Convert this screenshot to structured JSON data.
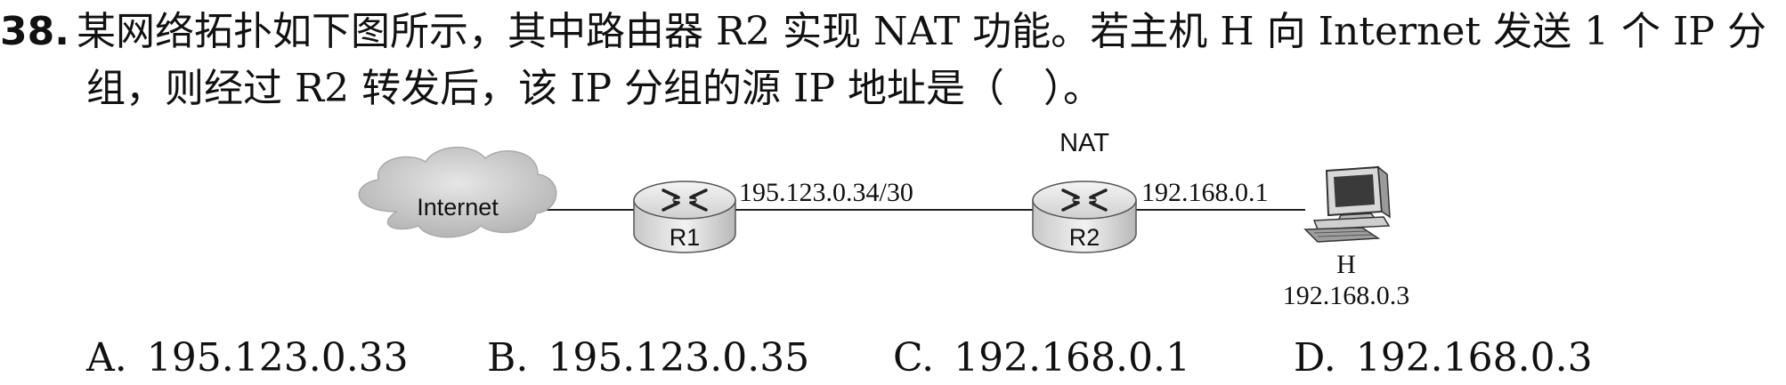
{
  "question": {
    "number": "38.",
    "line1": "某网络拓扑如下图所示，其中路由器 R2 实现 NAT 功能。若主机 H 向 Internet 发送 1 个 IP 分",
    "line2": "组，则经过 R2 转发后，该 IP 分组的源 IP 地址是（　）。"
  },
  "diagram": {
    "cloud_label": "Internet",
    "r1_label": "R1",
    "r1_link_ip": "195.123.0.34/30",
    "nat_label": "NAT",
    "r2_label": "R2",
    "r2_link_ip": "192.168.0.1",
    "host_label": "H",
    "host_ip": "192.168.0.3"
  },
  "options": [
    {
      "letter": "A.",
      "text": "195.123.0.33"
    },
    {
      "letter": "B.",
      "text": "195.123.0.35"
    },
    {
      "letter": "C.",
      "text": "192.168.0.1"
    },
    {
      "letter": "D.",
      "text": "192.168.0.3"
    }
  ]
}
